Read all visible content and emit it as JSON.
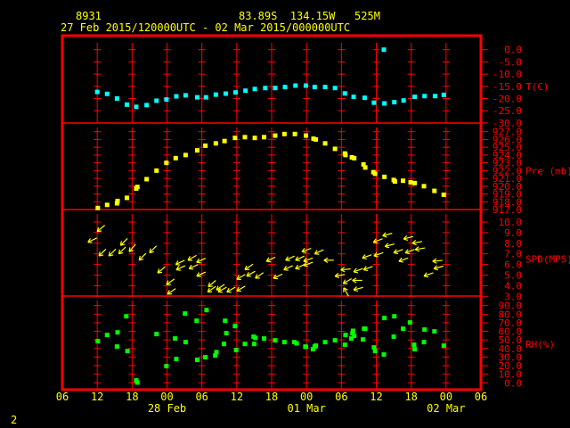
{
  "header": {
    "station": "8931",
    "location": "83.89S  134.15W   525M",
    "period": "27 Feb 2015/120000UTC - 02 Mar 2015/000000UTC"
  },
  "footer": {
    "page": "2"
  },
  "colors": {
    "frame": "#ff0000",
    "text": "#ffff00",
    "temperature": "#00ffff",
    "pressure": "#ffff00",
    "wind": "#ffff00",
    "rh": "#00ff00"
  },
  "chart_data": [
    {
      "type": "scatter",
      "ylabel": "T(C)",
      "ylim": [
        -30,
        0
      ],
      "yticks": [
        "0.0",
        "-5.0",
        "-10.0",
        "-15.0",
        "-20.0",
        "-25.0",
        "-30.0"
      ],
      "xlim": [
        "2015-02-27T06:00",
        "2015-03-02T06:00"
      ],
      "points": [
        [
          "2015-02-27T12:00",
          -17.3
        ],
        [
          "2015-02-27T13:42",
          -18.1
        ],
        [
          "2015-02-27T15:24",
          -20.0
        ],
        [
          "2015-02-27T17:06",
          -22.5
        ],
        [
          "2015-02-27T18:42",
          -23.4
        ],
        [
          "2015-02-27T20:30",
          -22.7
        ],
        [
          "2015-02-27T22:12",
          -20.9
        ],
        [
          "2015-02-27T23:54",
          -20.4
        ],
        [
          "2015-02-28T01:36",
          -19.1
        ],
        [
          "2015-02-28T03:12",
          -18.7
        ],
        [
          "2015-02-28T05:12",
          -19.5
        ],
        [
          "2015-02-28T06:42",
          -19.5
        ],
        [
          "2015-02-28T08:24",
          -18.4
        ],
        [
          "2015-02-28T10:06",
          -18.0
        ],
        [
          "2015-02-28T11:48",
          -17.5
        ],
        [
          "2015-02-28T13:30",
          -16.8
        ],
        [
          "2015-02-28T15:06",
          -16.1
        ],
        [
          "2015-02-28T16:54",
          -15.7
        ],
        [
          "2015-02-28T18:36",
          -15.7
        ],
        [
          "2015-02-28T20:18",
          -15.3
        ],
        [
          "2015-02-28T22:06",
          -14.7
        ],
        [
          "2015-02-28T23:54",
          -14.7
        ],
        [
          "2015-03-01T01:24",
          -15.3
        ],
        [
          "2015-03-01T03:12",
          -15.3
        ],
        [
          "2015-03-01T04:54",
          -15.7
        ],
        [
          "2015-03-01T06:36",
          -17.9
        ],
        [
          "2015-03-01T08:06",
          -19.3
        ],
        [
          "2015-03-01T10:00",
          -19.7
        ],
        [
          "2015-03-01T11:36",
          -21.7
        ],
        [
          "2015-03-01T13:18",
          0.0
        ],
        [
          "2015-03-01T13:24",
          -22.0
        ],
        [
          "2015-03-01T15:06",
          -21.5
        ],
        [
          "2015-03-01T16:42",
          -20.8
        ],
        [
          "2015-03-01T18:36",
          -19.3
        ],
        [
          "2015-03-01T20:18",
          -19.0
        ],
        [
          "2015-03-01T22:06",
          -19.0
        ],
        [
          "2015-03-01T23:36",
          -18.5
        ]
      ]
    },
    {
      "type": "scatter",
      "ylabel": "Pre (mb)",
      "ylim": [
        917,
        927
      ],
      "yticks": [
        "927.0",
        "926.0",
        "925.0",
        "924.0",
        "923.0",
        "922.0",
        "921.0",
        "920.0",
        "919.0",
        "918.0",
        "917.0"
      ],
      "xlim": [
        "2015-02-27T06:00",
        "2015-03-02T06:00"
      ],
      "points": [
        [
          "2015-02-27T12:06",
          917.2
        ],
        [
          "2015-02-27T13:42",
          917.6
        ],
        [
          "2015-02-27T15:24",
          917.8
        ],
        [
          "2015-02-27T15:30",
          918.1
        ],
        [
          "2015-02-27T17:06",
          918.5
        ],
        [
          "2015-02-27T18:42",
          919.7
        ],
        [
          "2015-02-27T18:54",
          919.9
        ],
        [
          "2015-02-27T20:30",
          920.9
        ],
        [
          "2015-02-27T22:12",
          922.0
        ],
        [
          "2015-02-27T23:54",
          923.0
        ],
        [
          "2015-02-28T01:30",
          923.6
        ],
        [
          "2015-02-28T03:12",
          924.0
        ],
        [
          "2015-02-28T05:12",
          924.6
        ],
        [
          "2015-02-28T06:36",
          925.2
        ],
        [
          "2015-02-28T08:24",
          925.5
        ],
        [
          "2015-02-28T09:54",
          925.8
        ],
        [
          "2015-02-28T11:42",
          926.2
        ],
        [
          "2015-02-28T13:24",
          926.3
        ],
        [
          "2015-02-28T15:06",
          926.2
        ],
        [
          "2015-02-28T16:42",
          926.3
        ],
        [
          "2015-02-28T18:36",
          926.5
        ],
        [
          "2015-02-28T20:12",
          926.7
        ],
        [
          "2015-02-28T22:00",
          926.7
        ],
        [
          "2015-02-28T23:54",
          926.5
        ],
        [
          "2015-03-01T01:12",
          926.1
        ],
        [
          "2015-03-01T01:36",
          926.0
        ],
        [
          "2015-03-01T03:12",
          925.5
        ],
        [
          "2015-03-01T04:54",
          924.8
        ],
        [
          "2015-03-01T06:36",
          924.2
        ],
        [
          "2015-03-01T06:42",
          924.0
        ],
        [
          "2015-03-01T07:48",
          923.7
        ],
        [
          "2015-03-01T08:12",
          923.6
        ],
        [
          "2015-03-01T09:48",
          922.8
        ],
        [
          "2015-03-01T10:06",
          922.4
        ],
        [
          "2015-03-01T11:30",
          921.8
        ],
        [
          "2015-03-01T11:48",
          921.6
        ],
        [
          "2015-03-01T13:24",
          921.2
        ],
        [
          "2015-03-01T15:00",
          920.8
        ],
        [
          "2015-03-01T15:12",
          920.6
        ],
        [
          "2015-03-01T16:36",
          920.7
        ],
        [
          "2015-03-01T17:54",
          920.5
        ],
        [
          "2015-03-01T18:36",
          920.4
        ],
        [
          "2015-03-01T20:12",
          920.0
        ],
        [
          "2015-03-01T22:00",
          919.4
        ],
        [
          "2015-03-01T23:36",
          918.9
        ]
      ]
    },
    {
      "type": "scatter",
      "ylabel": "SPD(MPS)",
      "ylim": [
        3,
        10
      ],
      "yticks": [
        "10.0",
        "9.0",
        "8.0",
        "7.0",
        "6.0",
        "5.0",
        "4.0",
        "3.0"
      ],
      "xlim": [
        "2015-02-27T06:00",
        "2015-03-02T06:00"
      ],
      "point_fields": [
        "time",
        "speed",
        "direction_deg"
      ],
      "points": [
        [
          "2015-02-27T10:24",
          8.1,
          65
        ],
        [
          "2015-02-27T12:00",
          9.1,
          50
        ],
        [
          "2015-02-27T12:18",
          6.8,
          45
        ],
        [
          "2015-02-27T14:00",
          6.8,
          45
        ],
        [
          "2015-02-27T15:42",
          7.0,
          45
        ],
        [
          "2015-02-27T16:00",
          7.8,
          45
        ],
        [
          "2015-02-27T17:30",
          7.2,
          40
        ],
        [
          "2015-02-27T19:12",
          6.4,
          45
        ],
        [
          "2015-02-27T21:00",
          7.1,
          45
        ],
        [
          "2015-02-27T22:24",
          5.2,
          50
        ],
        [
          "2015-02-27T23:54",
          4.1,
          55
        ],
        [
          "2015-02-28T00:06",
          3.2,
          55
        ],
        [
          "2015-02-28T01:30",
          6.0,
          65
        ],
        [
          "2015-02-28T01:36",
          5.5,
          65
        ],
        [
          "2015-02-28T03:36",
          6.4,
          60
        ],
        [
          "2015-02-28T03:48",
          5.6,
          65
        ],
        [
          "2015-02-28T05:06",
          6.2,
          65
        ],
        [
          "2015-02-28T05:06",
          4.9,
          65
        ],
        [
          "2015-02-28T07:00",
          3.4,
          55
        ],
        [
          "2015-02-28T07:06",
          3.9,
          50
        ],
        [
          "2015-02-28T08:30",
          3.6,
          55
        ],
        [
          "2015-02-28T08:48",
          3.4,
          60
        ],
        [
          "2015-02-28T10:18",
          3.4,
          60
        ],
        [
          "2015-02-28T12:00",
          4.6,
          60
        ],
        [
          "2015-02-28T12:00",
          3.5,
          60
        ],
        [
          "2015-02-28T13:24",
          5.5,
          55
        ],
        [
          "2015-02-28T13:42",
          4.9,
          60
        ],
        [
          "2015-02-28T15:12",
          4.7,
          55
        ],
        [
          "2015-02-28T17:06",
          6.3,
          65
        ],
        [
          "2015-02-28T18:18",
          4.7,
          65
        ],
        [
          "2015-02-28T20:06",
          5.5,
          65
        ],
        [
          "2015-02-28T20:24",
          6.4,
          65
        ],
        [
          "2015-02-28T22:06",
          6.4,
          65
        ],
        [
          "2015-02-28T22:06",
          5.6,
          65
        ],
        [
          "2015-02-28T23:12",
          7.2,
          70
        ],
        [
          "2015-02-28T23:30",
          6.3,
          70
        ],
        [
          "2015-02-28T23:30",
          5.9,
          70
        ],
        [
          "2015-03-01T01:24",
          7.0,
          65
        ],
        [
          "2015-03-01T03:00",
          6.4,
          90
        ],
        [
          "2015-03-01T04:54",
          4.9,
          80
        ],
        [
          "2015-03-01T05:54",
          5.5,
          85
        ],
        [
          "2015-03-01T06:18",
          4.2,
          60
        ],
        [
          "2015-03-01T06:24",
          3.8,
          150
        ],
        [
          "2015-03-01T07:54",
          4.5,
          90
        ],
        [
          "2015-03-01T08:06",
          3.6,
          75
        ],
        [
          "2015-03-01T08:06",
          5.3,
          70
        ],
        [
          "2015-03-01T09:36",
          6.6,
          70
        ],
        [
          "2015-03-01T09:48",
          5.5,
          70
        ],
        [
          "2015-03-01T11:30",
          8.1,
          70
        ],
        [
          "2015-03-01T11:36",
          6.8,
          70
        ],
        [
          "2015-03-01T13:06",
          8.7,
          75
        ],
        [
          "2015-03-01T13:30",
          7.7,
          75
        ],
        [
          "2015-03-01T15:00",
          7.1,
          70
        ],
        [
          "2015-03-01T15:54",
          6.3,
          70
        ],
        [
          "2015-03-01T16:42",
          8.4,
          75
        ],
        [
          "2015-03-01T17:00",
          7.1,
          70
        ],
        [
          "2015-03-01T18:12",
          8.0,
          80
        ],
        [
          "2015-03-01T18:42",
          7.4,
          80
        ],
        [
          "2015-03-01T20:12",
          4.9,
          70
        ],
        [
          "2015-03-01T21:42",
          6.3,
          85
        ],
        [
          "2015-03-01T21:54",
          5.6,
          75
        ]
      ]
    },
    {
      "type": "scatter",
      "ylabel": "RH(%)",
      "ylim": [
        0,
        90
      ],
      "yticks": [
        "90.0",
        "80.0",
        "70.0",
        "60.0",
        "50.0",
        "40.0",
        "30.0",
        "20.0",
        "10.0",
        "0.0"
      ],
      "xlim": [
        "2015-02-27T06:00",
        "2015-03-02T06:00"
      ],
      "xticks": [
        "06",
        "12",
        "18",
        "00",
        "06",
        "12",
        "18",
        "00",
        "06",
        "12",
        "18",
        "00",
        "06"
      ],
      "date_labels": [
        "28 Feb",
        "01 Mar",
        "02 Mar"
      ],
      "points": [
        [
          "2015-02-27T12:06",
          48.5
        ],
        [
          "2015-02-27T13:42",
          55.7
        ],
        [
          "2015-02-27T15:30",
          58.8
        ],
        [
          "2015-02-27T15:24",
          42.2
        ],
        [
          "2015-02-27T17:00",
          77.5
        ],
        [
          "2015-02-27T17:12",
          37.0
        ],
        [
          "2015-02-27T18:42",
          2.8
        ],
        [
          "2015-02-27T18:54",
          0.3
        ],
        [
          "2015-02-27T22:12",
          56.8
        ],
        [
          "2015-02-27T23:54",
          19.4
        ],
        [
          "2015-02-28T01:24",
          51.6
        ],
        [
          "2015-02-28T01:36",
          27.7
        ],
        [
          "2015-02-28T03:06",
          80.7
        ],
        [
          "2015-02-28T03:12",
          47.4
        ],
        [
          "2015-02-28T05:06",
          72.3
        ],
        [
          "2015-02-28T05:12",
          26.7
        ],
        [
          "2015-02-28T06:36",
          29.8
        ],
        [
          "2015-02-28T06:48",
          84.8
        ],
        [
          "2015-02-28T08:18",
          31.8
        ],
        [
          "2015-02-28T08:30",
          35.7
        ],
        [
          "2015-02-28T09:48",
          45.3
        ],
        [
          "2015-02-28T10:00",
          72.3
        ],
        [
          "2015-02-28T10:12",
          57.8
        ],
        [
          "2015-02-28T11:42",
          66.1
        ],
        [
          "2015-02-28T11:54",
          38.1
        ],
        [
          "2015-02-28T13:24",
          45.3
        ],
        [
          "2015-02-28T14:54",
          53.7
        ],
        [
          "2015-02-28T15:00",
          45.3
        ],
        [
          "2015-02-28T15:12",
          52.3
        ],
        [
          "2015-02-28T16:42",
          51.6
        ],
        [
          "2015-02-28T18:36",
          49.5
        ],
        [
          "2015-02-28T20:12",
          47.4
        ],
        [
          "2015-02-28T21:54",
          47.4
        ],
        [
          "2015-02-28T22:18",
          46.0
        ],
        [
          "2015-02-28T23:48",
          42.2
        ],
        [
          "2015-02-28T23:54",
          41.9
        ],
        [
          "2015-03-01T01:06",
          39.1
        ],
        [
          "2015-03-01T01:24",
          42.2
        ],
        [
          "2015-03-01T01:36",
          43.3
        ],
        [
          "2015-03-01T03:12",
          47.4
        ],
        [
          "2015-03-01T04:54",
          49.5
        ],
        [
          "2015-03-01T06:36",
          44.3
        ],
        [
          "2015-03-01T06:42",
          55.7
        ],
        [
          "2015-03-01T07:42",
          51.6
        ],
        [
          "2015-03-01T07:54",
          57.8
        ],
        [
          "2015-03-01T08:00",
          60.6
        ],
        [
          "2015-03-01T08:12",
          54.7
        ],
        [
          "2015-03-01T09:42",
          50.5
        ],
        [
          "2015-03-01T09:54",
          63.0
        ],
        [
          "2015-03-01T10:06",
          63.0
        ],
        [
          "2015-03-01T11:36",
          41.2
        ],
        [
          "2015-03-01T11:48",
          37.0
        ],
        [
          "2015-03-01T13:18",
          32.9
        ],
        [
          "2015-03-01T13:24",
          75.5
        ],
        [
          "2015-03-01T15:00",
          53.7
        ],
        [
          "2015-03-01T15:06",
          77.5
        ],
        [
          "2015-03-01T16:36",
          63.0
        ],
        [
          "2015-03-01T17:48",
          70.3
        ],
        [
          "2015-03-01T18:30",
          44.3
        ],
        [
          "2015-03-01T18:36",
          39.1
        ],
        [
          "2015-03-01T20:12",
          47.4
        ],
        [
          "2015-03-01T20:18",
          62.0
        ],
        [
          "2015-03-01T22:00",
          59.9
        ],
        [
          "2015-03-01T23:36",
          43.3
        ]
      ]
    }
  ]
}
